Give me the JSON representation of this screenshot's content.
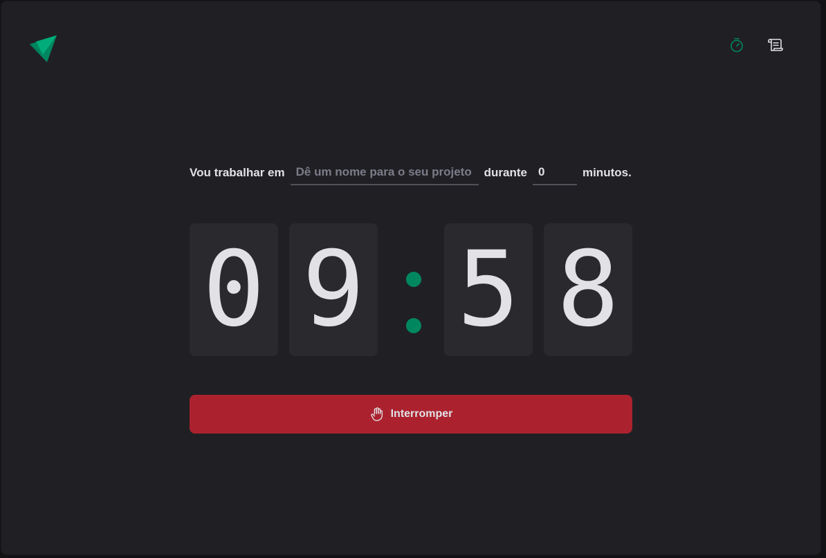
{
  "header": {
    "logo": "ignite-logo",
    "nav": [
      {
        "icon": "timer-icon",
        "active": true
      },
      {
        "icon": "scroll-icon",
        "active": false
      }
    ]
  },
  "form": {
    "prefix": "Vou trabalhar em",
    "task_value": "",
    "task_placeholder": "Dê um nome para o seu projeto",
    "middle": "durante",
    "minutes_value": "0",
    "suffix": "minutos."
  },
  "countdown": {
    "minutes": [
      "0",
      "9"
    ],
    "separator": ":",
    "seconds": [
      "5",
      "8"
    ]
  },
  "stop_button": {
    "label": "Interromper",
    "icon": "hand-palm-icon"
  },
  "colors": {
    "accent": "#00875f",
    "danger": "#ab222e",
    "background": "#202024",
    "digit_bg": "#29292e",
    "text": "#e1e1e6"
  }
}
